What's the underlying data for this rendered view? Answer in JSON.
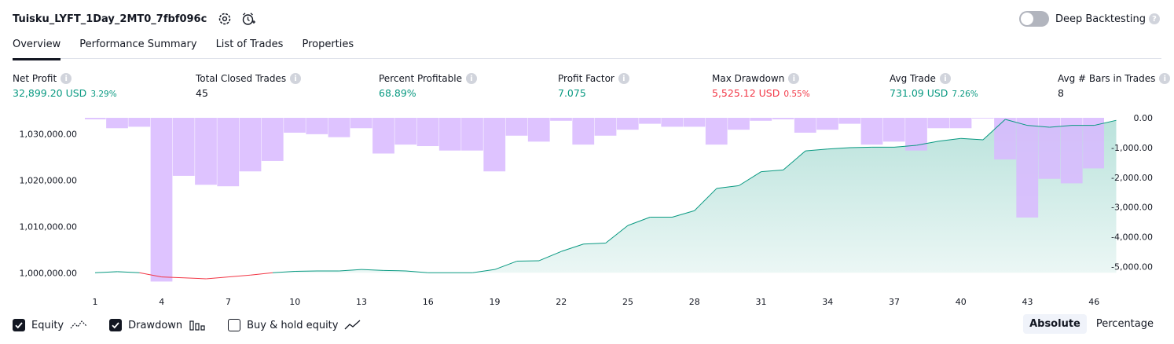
{
  "header": {
    "title": "Tuisku_LYFT_1Day_2MT0_7fbf096c",
    "settings_icon": "settings-icon",
    "alarm_icon": "alarm-add-icon",
    "deep_backtesting_label": "Deep Backtesting",
    "deep_backtesting_enabled": false,
    "help_glyph": "?"
  },
  "tabs": [
    {
      "label": "Overview",
      "active": true
    },
    {
      "label": "Performance Summary",
      "active": false
    },
    {
      "label": "List of Trades",
      "active": false
    },
    {
      "label": "Properties",
      "active": false
    }
  ],
  "metrics": [
    {
      "label": "Net Profit",
      "value": "32,899.20 USD",
      "pct": "3.29%",
      "color": "#089981"
    },
    {
      "label": "Total Closed Trades",
      "value": "45",
      "pct": "",
      "color": "#131722"
    },
    {
      "label": "Percent Profitable",
      "value": "68.89%",
      "pct": "",
      "color": "#089981"
    },
    {
      "label": "Profit Factor",
      "value": "7.075",
      "pct": "",
      "color": "#089981"
    },
    {
      "label": "Max Drawdown",
      "value": "5,525.12 USD",
      "pct": "0.55%",
      "color": "#f23645"
    },
    {
      "label": "Avg Trade",
      "value": "731.09 USD",
      "pct": "7.26%",
      "color": "#089981"
    },
    {
      "label": "Avg # Bars in Trades",
      "value": "8",
      "pct": "",
      "color": "#131722"
    }
  ],
  "info_glyph": "i",
  "chart_data": {
    "type": "area",
    "x_ticks": [
      "1",
      "4",
      "7",
      "10",
      "13",
      "16",
      "19",
      "22",
      "25",
      "28",
      "31",
      "34",
      "37",
      "40",
      "43",
      "46"
    ],
    "left_ticks": [
      {
        "label": "1,030,000.00",
        "value": 1030000
      },
      {
        "label": "1,020,000.00",
        "value": 1020000
      },
      {
        "label": "1,010,000.00",
        "value": 1010000
      },
      {
        "label": "1,000,000.00",
        "value": 1000000
      }
    ],
    "right_ticks": [
      {
        "label": "0.00",
        "value": 0
      },
      {
        "label": "-1,000.00",
        "value": -1000
      },
      {
        "label": "-2,000.00",
        "value": -2000
      },
      {
        "label": "-3,000.00",
        "value": -3000
      },
      {
        "label": "-4,000.00",
        "value": -4000
      },
      {
        "label": "-5,000.00",
        "value": -5000
      }
    ],
    "equity_baseline": 1000000,
    "equity": [
      1000000,
      1000250,
      1000000,
      999100,
      998900,
      998700,
      999100,
      999500,
      1000000,
      1000300,
      1000400,
      1000400,
      1000700,
      1000500,
      1000400,
      1000000,
      1000000,
      1000000,
      1000700,
      1002500,
      1002600,
      1004600,
      1006200,
      1006400,
      1010200,
      1012000,
      1012000,
      1013400,
      1018200,
      1018800,
      1021800,
      1022200,
      1026300,
      1026700,
      1027000,
      1027100,
      1027100,
      1027500,
      1028400,
      1029000,
      1028700,
      1033100,
      1031800,
      1031400,
      1031800,
      1031800,
      1032900
    ],
    "drawdown": [
      -50,
      -350,
      -300,
      -5500,
      -1950,
      -2250,
      -2300,
      -1800,
      -1450,
      -500,
      -550,
      -650,
      -350,
      -1200,
      -900,
      -950,
      -1100,
      -1100,
      -1800,
      -600,
      -800,
      -100,
      -900,
      -600,
      -400,
      -200,
      -300,
      -300,
      -900,
      -400,
      -100,
      -50,
      -500,
      -400,
      -200,
      -900,
      -800,
      -1100,
      -350,
      -350,
      0,
      -1400,
      -3350,
      -2050,
      -2200,
      -1700,
      -1900
    ],
    "series": [
      {
        "name": "Equity"
      },
      {
        "name": "Drawdown"
      }
    ],
    "equity_up_color": "#089981",
    "equity_down_color": "#f23645",
    "equity_fill_color": "#089981",
    "drawdown_color": "#d8b8ff"
  },
  "legend": {
    "equity_label": "Equity",
    "equity_checked": true,
    "drawdown_label": "Drawdown",
    "drawdown_checked": true,
    "buyhold_label": "Buy & hold equity",
    "buyhold_checked": false
  },
  "modes": [
    {
      "label": "Absolute",
      "active": true
    },
    {
      "label": "Percentage",
      "active": false
    }
  ]
}
